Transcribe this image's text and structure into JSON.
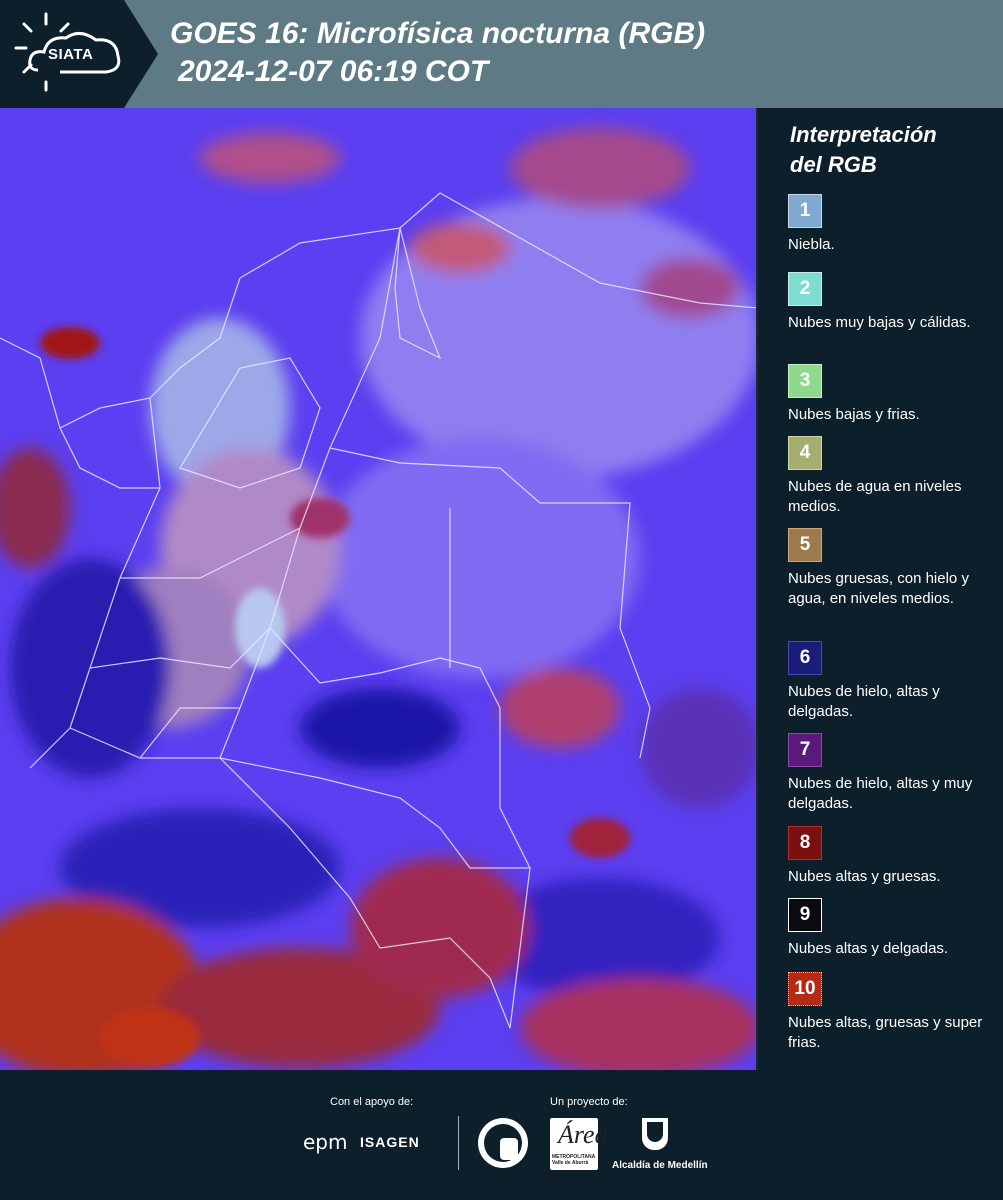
{
  "header": {
    "logo_text": "SIATA",
    "title": "GOES 16: Microfísica nocturna (RGB)",
    "subtitle": "2024-12-07 06:19 COT"
  },
  "legend": {
    "title_line1": "Interpretación",
    "title_line2": "del RGB",
    "items": [
      {
        "number": "1",
        "label": "Niebla.",
        "color": "#7fa9cf"
      },
      {
        "number": "2",
        "label": "Nubes muy bajas y cálidas.",
        "color": "#7fdcd0"
      },
      {
        "number": "3",
        "label": "Nubes bajas y frias.",
        "color": "#8fd98f"
      },
      {
        "number": "4",
        "label": "Nubes de agua en niveles medios.",
        "color": "#a5ad70"
      },
      {
        "number": "5",
        "label": "Nubes gruesas, con hielo y agua, en niveles medios.",
        "color": "#9c7a4c"
      },
      {
        "number": "6",
        "label": "Nubes de hielo, altas y delgadas.",
        "color": "#1c1c7a"
      },
      {
        "number": "7",
        "label": "Nubes de hielo, altas y muy delgadas.",
        "color": "#5a1a7a"
      },
      {
        "number": "8",
        "label": "Nubes altas y gruesas.",
        "color": "#7a1010"
      },
      {
        "number": "9",
        "label": "Nubes altas y delgadas.",
        "color": "#0a0a10"
      },
      {
        "number": "10",
        "label": "Nubes altas, gruesas y super frias.",
        "color": "#b52a14"
      }
    ]
  },
  "footer": {
    "support_label": "Con el apoyo de:",
    "project_label": "Un proyecto de:",
    "epm": "epm",
    "isagen": "ISAGEN",
    "area_letter": "Área",
    "area_small": "METROPOLITANA Valle de Aburrá",
    "medellin": "Alcaldía de Medellín"
  }
}
